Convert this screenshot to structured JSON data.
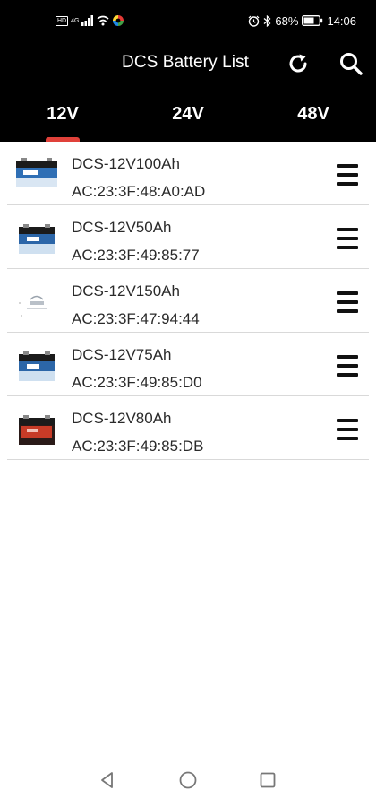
{
  "status_bar": {
    "sim_badge": "HD",
    "network": "4G",
    "battery_percent": "68%",
    "time": "14:06",
    "icons": [
      "hd-badge-icon",
      "signal-icon",
      "wifi-icon",
      "app-notification-icon",
      "alarm-icon",
      "bluetooth-icon",
      "battery-icon"
    ]
  },
  "header": {
    "title": "DCS Battery List",
    "refresh_icon": "refresh-icon",
    "search_icon": "search-icon",
    "background": "#000000"
  },
  "tabs": [
    {
      "label": "12V",
      "selected": true
    },
    {
      "label": "24V",
      "selected": false
    },
    {
      "label": "48V",
      "selected": false
    }
  ],
  "accent_color": "#e0413a",
  "batteries": [
    {
      "name": "DCS-12V100Ah",
      "mac": "AC:23:3F:48:A0:AD",
      "image": "battery-blue-wide-icon"
    },
    {
      "name": "DCS-12V50Ah",
      "mac": "AC:23:3F:49:85:77",
      "image": "battery-blue-icon"
    },
    {
      "name": "DCS-12V150Ah",
      "mac": "AC:23:3F:47:94:44",
      "image": "battery-logo-placeholder-icon"
    },
    {
      "name": "DCS-12V75Ah",
      "mac": "AC:23:3F:49:85:D0",
      "image": "battery-blue-icon"
    },
    {
      "name": "DCS-12V80Ah",
      "mac": "AC:23:3F:49:85:DB",
      "image": "battery-red-icon"
    }
  ],
  "nav_bar": {
    "icons": [
      "back-icon",
      "home-icon",
      "recents-icon"
    ]
  }
}
